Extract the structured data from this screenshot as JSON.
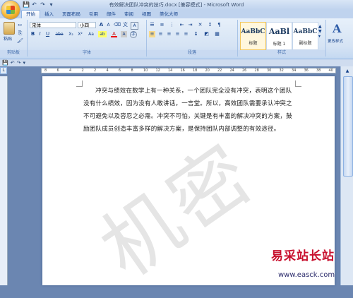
{
  "window": {
    "title": "有效解决团队冲突的技巧.docx [兼容模式] - Microsoft Word"
  },
  "quick_access": {
    "save": "💾",
    "undo": "↶",
    "redo": "↷",
    "more": "▾"
  },
  "tabs": [
    "开始",
    "插入",
    "页面布局",
    "引用",
    "邮件",
    "审阅",
    "视图",
    "美化大师"
  ],
  "ribbon": {
    "clipboard": {
      "paste": "粘贴",
      "label": "剪贴板"
    },
    "font": {
      "name": "宋体",
      "size": "小四",
      "label": "字体",
      "grow": "A",
      "shrink": "A",
      "bold": "B",
      "italic": "I",
      "underline": "U",
      "strike": "abe",
      "sub": "X₂",
      "sup": "X²",
      "case": "Aa",
      "highlight": "ab",
      "color": "A",
      "charshade": "A",
      "phonetic": "文"
    },
    "paragraph": {
      "label": "段落"
    },
    "styles": {
      "label": "样式",
      "tiles": [
        {
          "sample": "AaBbC",
          "name": "标题"
        },
        {
          "sample": "AaBl",
          "name": "标题 1"
        },
        {
          "sample": "AaBbC",
          "name": "副标题"
        }
      ],
      "change": "更改样式"
    }
  },
  "ruler": {
    "numbers": [
      "8",
      "6",
      "4",
      "2",
      "2",
      "4",
      "6",
      "8",
      "10",
      "12",
      "14",
      "16",
      "18",
      "20",
      "22",
      "24",
      "26",
      "28",
      "30",
      "32",
      "34",
      "36",
      "38",
      "40"
    ]
  },
  "document": {
    "paragraph": "冲突与绩效在数学上有一种关系，一个团队完全没有冲突，表明这个团队没有什么绩效，因为没有人敢讲话，一言堂。所以，高效团队需要承认冲突之不可避免以及容忍之必需。冲突不可怕，关键是有丰富的解决冲突的方案，鼓励团队成员创造丰富多样的解决方案，是保持团队内部调整的有效途径。"
  },
  "watermark": {
    "overlay": "机密",
    "site_name": "易采站长站",
    "site_url": "www.easck.com"
  }
}
